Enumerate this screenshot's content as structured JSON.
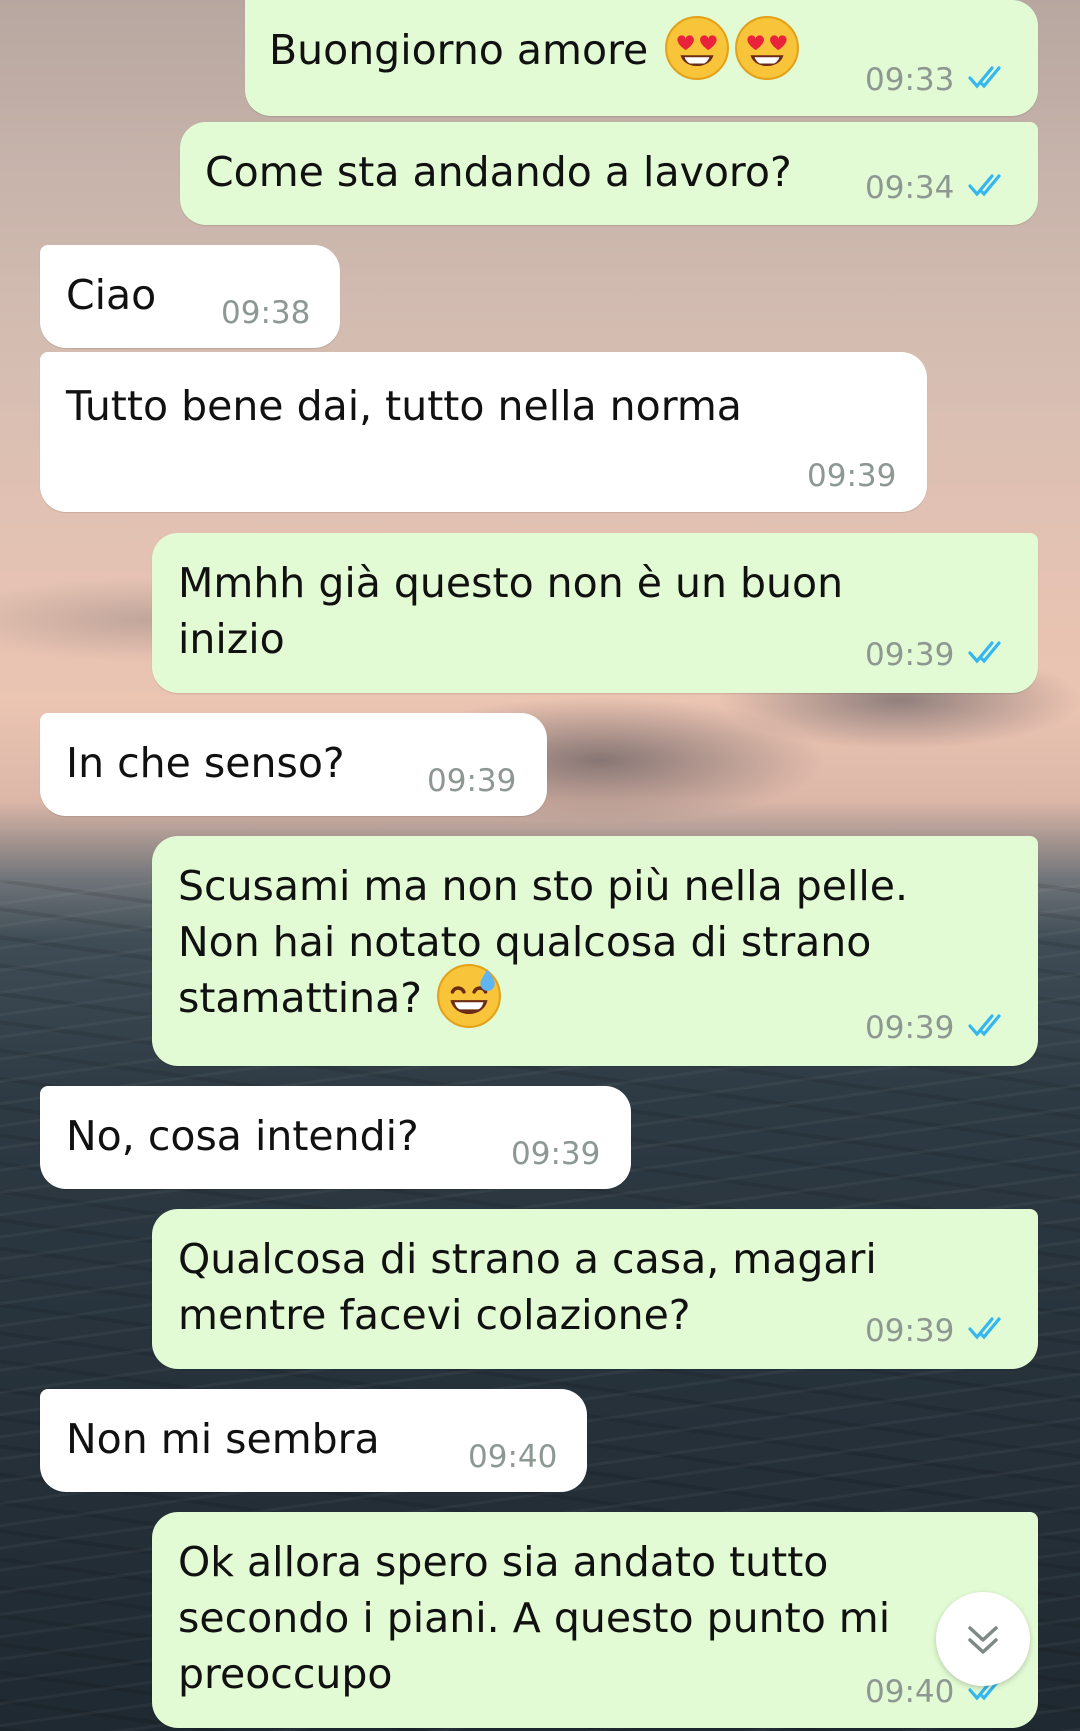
{
  "messages": [
    {
      "side": "out",
      "text": "Buongiorno amore",
      "time": "09:33",
      "status": "read",
      "emoji": "heart-eyes x2"
    },
    {
      "side": "out",
      "text": "Come sta andando a lavoro?",
      "time": "09:34",
      "status": "read"
    },
    {
      "side": "in",
      "text": "Ciao",
      "time": "09:38"
    },
    {
      "side": "in",
      "text": "Tutto bene dai, tutto nella norma",
      "time": "09:39"
    },
    {
      "side": "out",
      "text": "Mmhh già questo non è un buon\ninizio",
      "time": "09:39",
      "status": "read"
    },
    {
      "side": "in",
      "text": "In che senso?",
      "time": "09:39"
    },
    {
      "side": "out",
      "text": "Scusami ma non sto più nella pelle.\nNon hai notato qualcosa di strano\nstamattina?",
      "time": "09:39",
      "status": "read",
      "emoji": "grinning-sweat"
    },
    {
      "side": "in",
      "text": "No, cosa intendi?",
      "time": "09:39"
    },
    {
      "side": "out",
      "text": "Qualcosa di strano a casa, magari\nmentre facevi colazione?",
      "time": "09:39",
      "status": "read"
    },
    {
      "side": "in",
      "text": "Non mi sembra",
      "time": "09:40"
    },
    {
      "side": "out",
      "text": "Ok allora spero sia andato tutto\nsecondo i piani. A questo punto mi\npreoccupo",
      "time": "09:40",
      "status": "read"
    }
  ],
  "colors": {
    "outgoing_bubble": "#e2fbd4",
    "incoming_bubble": "#ffffff",
    "read_ticks": "#34b7f1",
    "timestamp": "#8d9893"
  },
  "icons": {
    "read_receipt": "double-check-icon",
    "scroll_down": "double-chevron-down-icon"
  }
}
